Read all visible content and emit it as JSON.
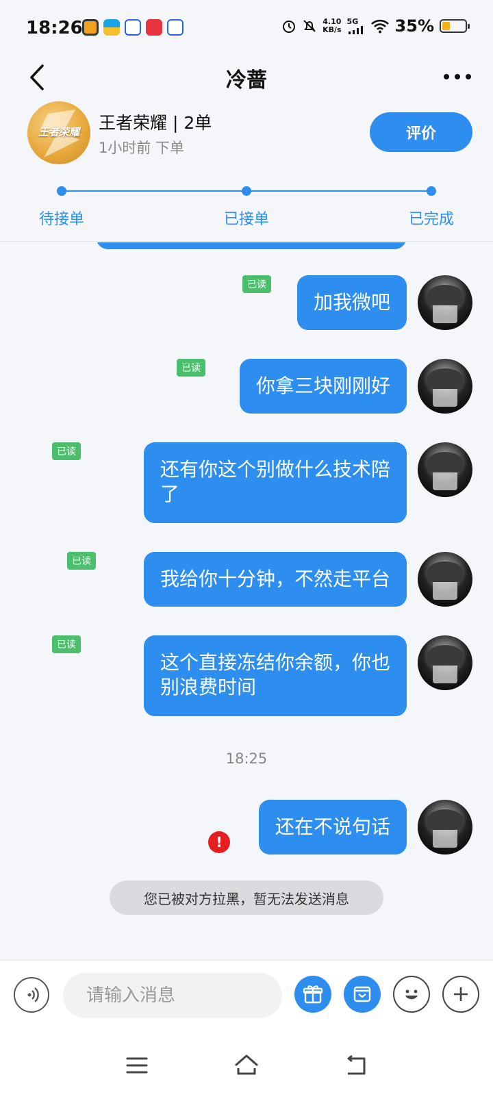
{
  "status_bar": {
    "time": "18:26",
    "net_speed_value": "4.10",
    "net_speed_unit": "KB/s",
    "network": "5G",
    "battery_pct": "35%",
    "battery_level": 0.35,
    "app_icons": [
      "browser-app-icon",
      "wallet-app-icon",
      "baidu-app-icon",
      "taobao-app-icon",
      "baidu-app-icon"
    ]
  },
  "nav": {
    "title": "冷蔷"
  },
  "order": {
    "title": "王者荣耀 | 2单",
    "subtitle": "1小时前 下单",
    "review_label": "评价",
    "steps": [
      "待接单",
      "已接单",
      "已完成"
    ],
    "logo_text": "王者荣耀"
  },
  "chat": {
    "read_label": "已读",
    "messages": [
      {
        "text": "加我微吧",
        "read": true
      },
      {
        "text": "你拿三块刚刚好",
        "read": true
      },
      {
        "line1": "还有你这个别做什么技术陪",
        "line2": "了",
        "read": true
      },
      {
        "text": "我给你十分钟，不然走平台",
        "read": true
      },
      {
        "line1": "这个直接冻结你余额，你也",
        "line2": "别浪费时间",
        "read": true
      }
    ],
    "timestamp": "18:25",
    "failed_message": "还在不说句话",
    "error_mark": "!",
    "system_notice": "您已被对方拉黑，暂无法发送消息"
  },
  "input_bar": {
    "placeholder": "请输入消息"
  },
  "colors": {
    "accent": "#2d8ef0",
    "read_tag": "#4cbf6c",
    "error": "#e51f1f"
  }
}
